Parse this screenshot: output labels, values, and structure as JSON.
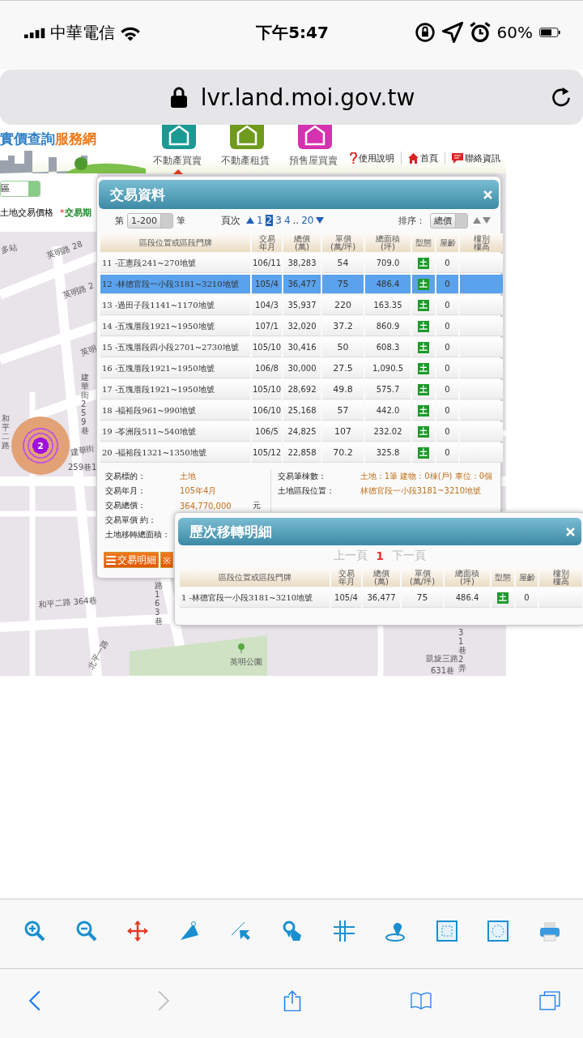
{
  "status_bar": {
    "carrier": "中華電信",
    "time": "下午5:47",
    "battery": "60%"
  },
  "address_bar": {
    "url": "lvr.land.moi.gov.tw"
  },
  "site_header": {
    "logo": "實價查詢",
    "logo_accent": "服務網",
    "nav_tabs": [
      {
        "label": "不動產買賣",
        "selected": true
      },
      {
        "label": "不動產租賃",
        "selected": false
      },
      {
        "label": "預售屋買賣",
        "selected": false
      }
    ],
    "links": [
      "使用說明",
      "首頁",
      "聯絡資訊"
    ]
  },
  "search_panel": {
    "district": "區",
    "land_price": "土地交易價格",
    "required_mark": "*",
    "period_label": "交易期"
  },
  "map_labels": [
    "多站",
    "英明路 28",
    "英明路 2",
    "英明",
    "和平二路",
    "建華街 259巷",
    "建華街",
    "259巷1",
    "和平二路 364巷",
    "路 163巷",
    "北平一路",
    "英明公園",
    "凱旋三路",
    "631巷",
    "31巷2弄"
  ],
  "cluster": {
    "count": "2"
  },
  "transaction_dialog": {
    "title": "交易資料",
    "range_prefix": "第",
    "range": "1-200",
    "range_suffix": "筆",
    "page_label": "頁次",
    "pages": [
      {
        "kind": "page",
        "label": "1",
        "selected": false
      },
      {
        "kind": "page",
        "label": "2",
        "selected": true
      },
      {
        "kind": "page",
        "label": "3",
        "selected": false
      },
      {
        "kind": "page",
        "label": "4",
        "selected": false
      },
      {
        "kind": "gap",
        "label": ".."
      },
      {
        "kind": "page",
        "label": "20",
        "selected": false
      }
    ],
    "sort_label": "排序：",
    "sort": "總價",
    "columns": [
      "區段位置或區段門牌",
      "交易年月",
      "總價\n(萬)",
      "單價\n(萬/坪)",
      "總面積\n(坪)",
      "型態",
      "屋齡",
      "樓別樓高"
    ],
    "rows": [
      {
        "location": "11 -正憲段241~270地號",
        "date": "106/11",
        "total": "38,283",
        "unit": "54",
        "area": "709.0",
        "type": "土",
        "age": "0",
        "selected": false
      },
      {
        "location": "12 -林德官段一小段3181~3210地號",
        "date": "105/4",
        "total": "36,477",
        "unit": "75",
        "area": "486.4",
        "type": "土",
        "age": "0",
        "selected": true
      },
      {
        "location": "13 -過田子段1141~1170地號",
        "date": "104/3",
        "total": "35,937",
        "unit": "220",
        "area": "163.35",
        "type": "土",
        "age": "0",
        "selected": false
      },
      {
        "location": "14 -五塊厝段1921~1950地號",
        "date": "107/1",
        "total": "32,020",
        "unit": "37.2",
        "area": "860.9",
        "type": "土",
        "age": "0",
        "selected": false
      },
      {
        "location": "15 -五塊厝段四小段2701~2730地號",
        "date": "105/10",
        "total": "30,416",
        "unit": "50",
        "area": "608.3",
        "type": "土",
        "age": "0",
        "selected": false
      },
      {
        "location": "16 -五塊厝段1921~1950地號",
        "date": "106/8",
        "total": "30,000",
        "unit": "27.5",
        "area": "1,090.5",
        "type": "土",
        "age": "0",
        "selected": false
      },
      {
        "location": "17 -五塊厝段1921~1950地號",
        "date": "105/10",
        "total": "28,692",
        "unit": "49.8",
        "area": "575.7",
        "type": "土",
        "age": "0",
        "selected": false
      },
      {
        "location": "18 -福裕段961~990地號",
        "date": "106/10",
        "total": "25,168",
        "unit": "57",
        "area": "442.0",
        "type": "土",
        "age": "0",
        "selected": false
      },
      {
        "location": "19 -苓洲段511~540地號",
        "date": "106/5",
        "total": "24,825",
        "unit": "107",
        "area": "232.02",
        "type": "土",
        "age": "0",
        "selected": false
      },
      {
        "location": "20 -福裕段1321~1350地號",
        "date": "105/12",
        "total": "22,858",
        "unit": "70.2",
        "area": "325.8",
        "type": "土",
        "age": "0",
        "selected": false
      }
    ],
    "details_left": [
      {
        "label": "交易標的：",
        "value": "土地"
      },
      {
        "label": "交易年月：",
        "value": "105年4月"
      },
      {
        "label": "交易總價：",
        "value": "364,770,000",
        "unit": "元"
      },
      {
        "label": "交易單價 約："
      },
      {
        "label": "土地移轉總面積："
      }
    ],
    "details_right": [
      {
        "label": "交易筆棟數：",
        "value": "土地：1筆 建物：0棟(戶) 車位：0個"
      },
      {
        "label": "土地區段位置：",
        "value": "林德官段一小段3181~3210地號"
      }
    ],
    "buttons": [
      "交易明細",
      "※"
    ]
  },
  "history_dialog": {
    "title": "歷次移轉明細",
    "prev": {
      "label": "上一頁",
      "disabled": true
    },
    "current": "1",
    "next": {
      "label": "下一頁",
      "disabled": true
    },
    "columns": [
      "區段位置或區段門牌",
      "交易年月",
      "總價\n(萬)",
      "單價\n(萬/坪)",
      "總面積\n(坪)",
      "型態",
      "屋齡",
      "樓別樓高"
    ],
    "rows": [
      {
        "location": "1 -林德官段一小段3181~3210地號",
        "date": "105/4",
        "total": "36,477",
        "unit": "75",
        "area": "486.4",
        "type": "土",
        "age": "0",
        "selected": false
      }
    ]
  },
  "browser_toolbar": {
    "back": {
      "disabled": false
    },
    "forward": {
      "disabled": true
    }
  }
}
